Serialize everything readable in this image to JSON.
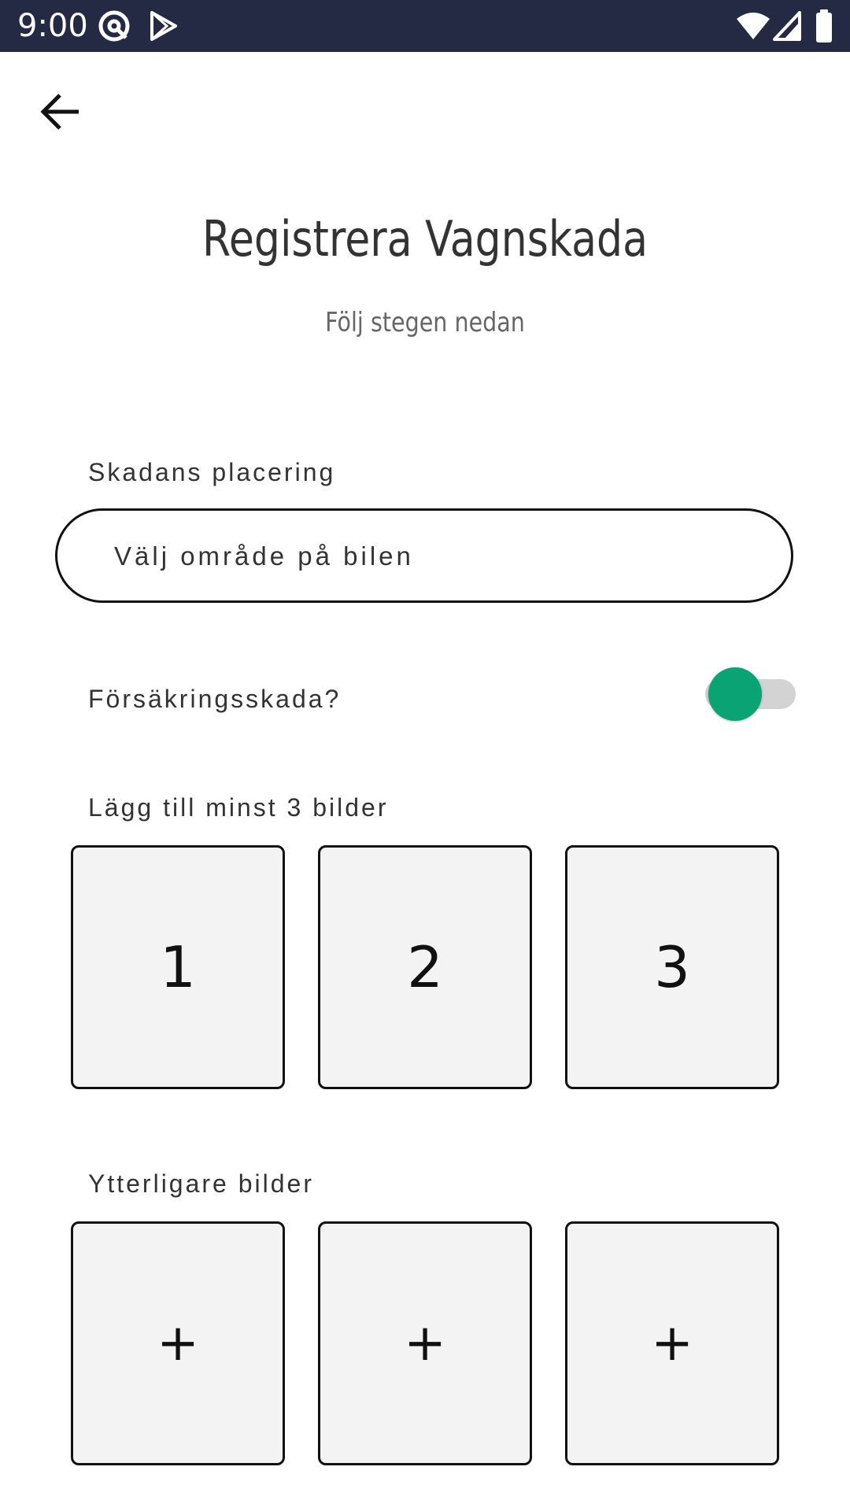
{
  "status_bar": {
    "time": "9:00",
    "icons": [
      "at-sign-icon",
      "play-store-icon",
      "wifi-icon",
      "signal-icon",
      "battery-icon"
    ]
  },
  "header": {
    "back_icon": "arrow-left-icon",
    "title": "Registrera Vagnskada",
    "subtitle": "Följ stegen nedan"
  },
  "damage_location": {
    "label": "Skadans placering",
    "placeholder": "Välj område på bilen"
  },
  "insurance": {
    "label": "Försäkringsskada?",
    "toggle_on": false,
    "thumb_color": "#0aa373",
    "track_color": "#d3d3d3"
  },
  "required_photos": {
    "label": "Lägg till minst 3 bilder",
    "slots": [
      "1",
      "2",
      "3"
    ]
  },
  "additional_photos": {
    "label": "Ytterligare bilder",
    "slots": [
      "+",
      "+",
      "+"
    ]
  },
  "colors": {
    "status_bar": "#242a44",
    "accent": "#0aa373"
  }
}
